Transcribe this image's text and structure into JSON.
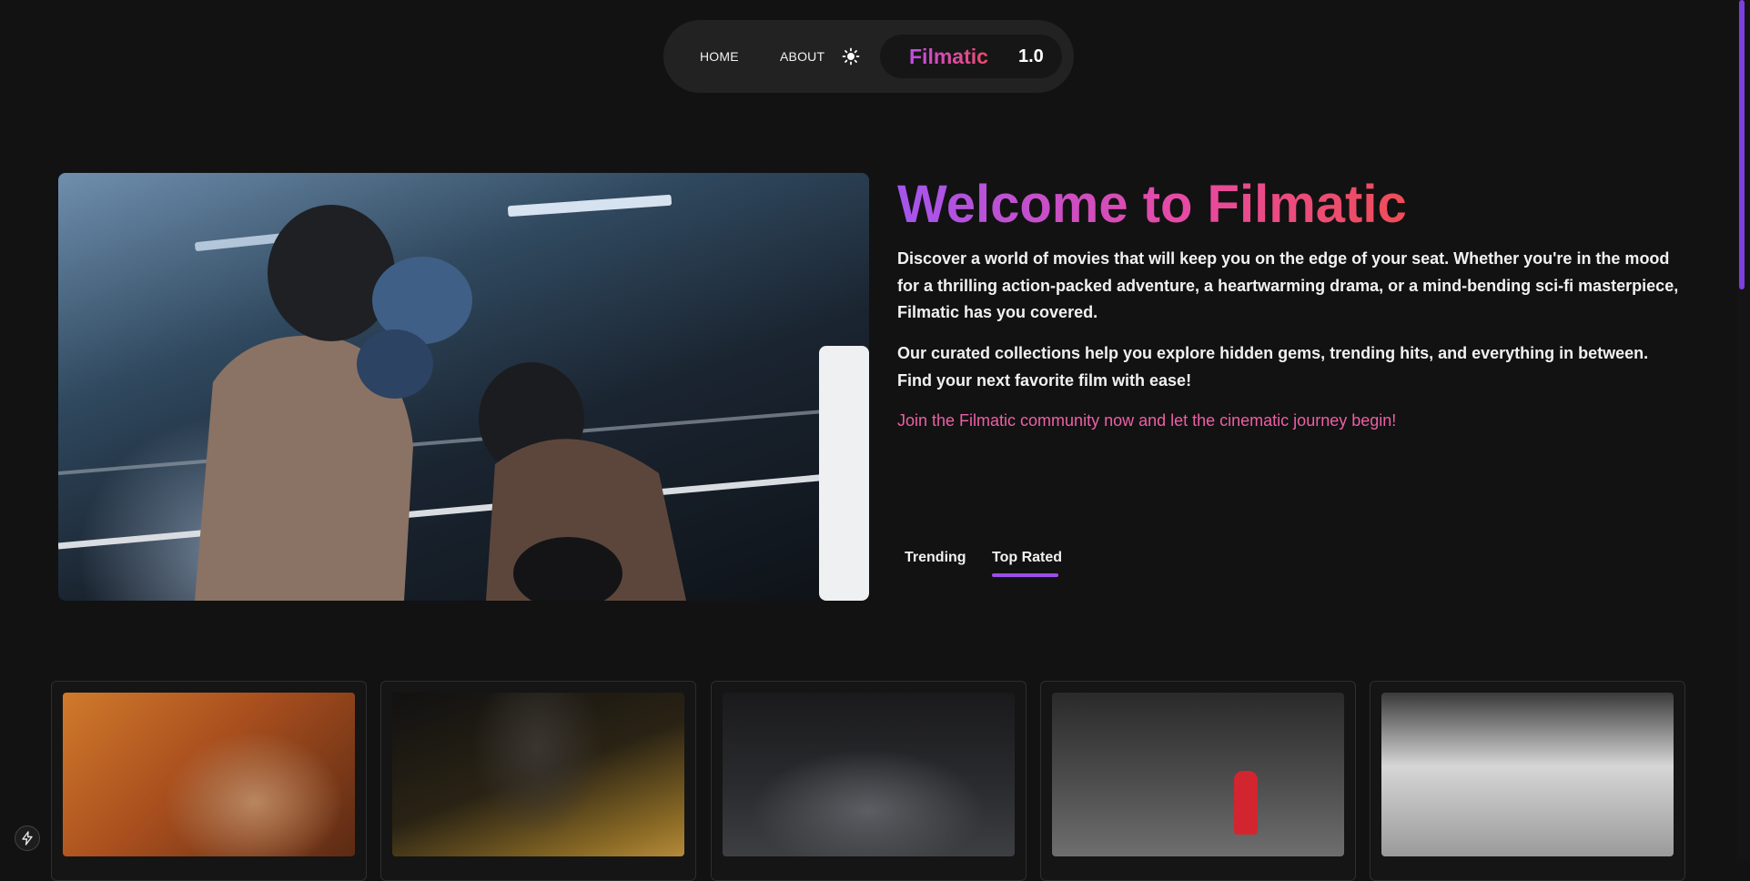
{
  "nav": {
    "home_label": "HOME",
    "about_label": "ABOUT",
    "theme_icon": "sun-icon",
    "brand_name": "Filmatic",
    "brand_version": "1.0"
  },
  "hero": {
    "image_icon": "hero-image",
    "title": "Welcome to Filmatic",
    "paragraph_1": "Discover a world of movies that will keep you on the edge of your seat. Whether you're in the mood for a thrilling action-packed adventure, a heartwarming drama, or a mind-bending sci-fi masterpiece, Filmatic has you covered.",
    "paragraph_2": "Our curated collections help you explore hidden gems, trending hits, and everything in between. Find your next favorite film with ease!",
    "cta": "Join the Filmatic community now and let the cinematic journey begin!"
  },
  "tabs": [
    {
      "label": "Trending",
      "active": false
    },
    {
      "label": "Top Rated",
      "active": true
    }
  ],
  "movies": [
    {
      "poster": "poster-1"
    },
    {
      "poster": "poster-2"
    },
    {
      "poster": "poster-3"
    },
    {
      "poster": "poster-4"
    },
    {
      "poster": "poster-5"
    }
  ],
  "colors": {
    "accent_purple": "#9b4fe8",
    "accent_pink": "#ee5fa7",
    "background": "#121212"
  },
  "floating_button": {
    "icon": "lightning-icon"
  }
}
